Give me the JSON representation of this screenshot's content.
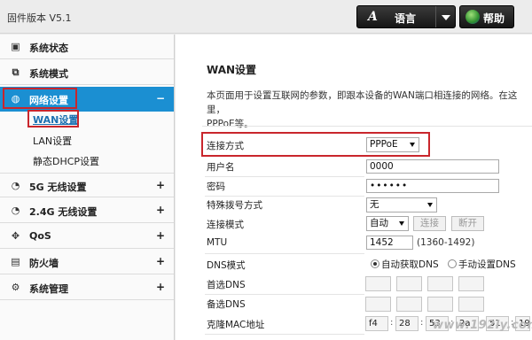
{
  "header": {
    "firmware": "固件版本 V5.1",
    "language_icon": "A",
    "language_label": "语言",
    "help_label": "帮助"
  },
  "sidebar": {
    "items": [
      {
        "label": "系统状态",
        "icon": "status-icon",
        "glyph": "▣"
      },
      {
        "label": "系统模式",
        "icon": "mode-icon",
        "glyph": "⧉"
      },
      {
        "label": "网络设置",
        "icon": "globe-icon",
        "glyph": "◍",
        "toggle": "−"
      },
      {
        "label": "5G 无线设置",
        "icon": "wifi-icon",
        "glyph": "◔",
        "toggle": "+"
      },
      {
        "label": "2.4G 无线设置",
        "icon": "wifi-icon",
        "glyph": "◔",
        "toggle": "+"
      },
      {
        "label": "QoS",
        "icon": "qos-icon",
        "glyph": "✥",
        "toggle": "+"
      },
      {
        "label": "防火墙",
        "icon": "lock-icon",
        "glyph": "▤",
        "toggle": "+"
      },
      {
        "label": "系统管理",
        "icon": "gear-icon",
        "glyph": "⚙",
        "toggle": "+"
      }
    ],
    "subitems": [
      "WAN设置",
      "LAN设置",
      "静态DHCP设置"
    ]
  },
  "main": {
    "title": "WAN设置",
    "desc_line1": "本页面用于设置互联网的参数，即跟本设备的WAN端口相连接的网络。在这里，",
    "desc_line2": "PPPoE等。",
    "fields": {
      "conn_type_label": "连接方式",
      "conn_type_value": "PPPoE",
      "username_label": "用户名",
      "username_value": "0000",
      "password_label": "密码",
      "password_value": "••••••",
      "special_dial_label": "特殊拨号方式",
      "special_dial_value": "无",
      "conn_mode_label": "连接模式",
      "conn_mode_value": "自动",
      "connect_btn": "连接",
      "disconnect_btn": "断开",
      "mtu_label": "MTU",
      "mtu_value": "1452",
      "mtu_hint": "(1360-1492)",
      "dns_mode_label": "DNS模式",
      "dns_auto": "自动获取DNS",
      "dns_manual": "手动设置DNS",
      "dns_primary_label": "首选DNS",
      "dns_secondary_label": "备选DNS",
      "mac_clone_label": "克隆MAC地址",
      "mac_octets": [
        "f4",
        "28",
        "53",
        "2a",
        "51",
        "19"
      ]
    }
  },
  "watermark": "www.192ly.com",
  "colors": {
    "accent": "#1b8fd2",
    "highlight": "#c9262c"
  }
}
